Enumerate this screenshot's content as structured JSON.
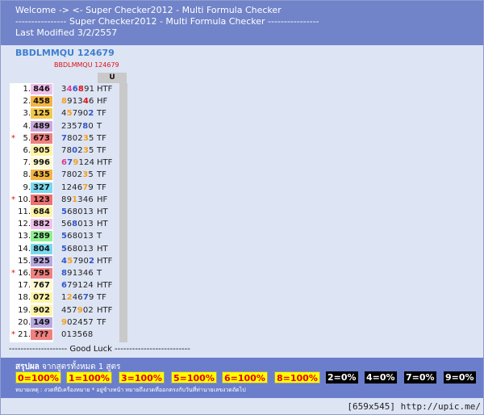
{
  "header": {
    "line1": "Welcome -> <- Super Checker2012 - Multi Formula Checker",
    "line2": "---------------- Super Checker2012 - Multi Formula Checker ----------------",
    "line3": "Last Modified 3/2/2557"
  },
  "code_title": "BBDLMMQU 124679",
  "code_sub": "BBDLMMQU 124679",
  "column_header": "U",
  "rows": [
    {
      "star": "",
      "idx": "1.",
      "num": "846",
      "bg": "#f1c0ea",
      "digits": [
        [
          "3",
          "#222"
        ],
        [
          "4",
          "#e03b8f"
        ],
        [
          "6",
          "#3355cc"
        ],
        [
          "8",
          "#dd1111"
        ],
        [
          "9",
          "#222"
        ],
        [
          "1",
          "#222"
        ]
      ],
      "type": "HTF"
    },
    {
      "star": "",
      "idx": "2.",
      "num": "458",
      "bg": "#f4b443",
      "digits": [
        [
          "8",
          "#f4a020"
        ],
        [
          "9",
          "#222"
        ],
        [
          "1",
          "#222"
        ],
        [
          "3",
          "#222"
        ],
        [
          "4",
          "#dd1111"
        ],
        [
          "6",
          "#222"
        ]
      ],
      "type": "HF"
    },
    {
      "star": "",
      "idx": "3.",
      "num": "125",
      "bg": "#f4c84a",
      "digits": [
        [
          "4",
          "#222"
        ],
        [
          "5",
          "#f4a020"
        ],
        [
          "7",
          "#222"
        ],
        [
          "9",
          "#222"
        ],
        [
          "0",
          "#222"
        ],
        [
          "2",
          "#3355cc"
        ]
      ],
      "type": "TF"
    },
    {
      "star": "",
      "idx": "4.",
      "num": "489",
      "bg": "#c9a9d9",
      "digits": [
        [
          "2",
          "#222"
        ],
        [
          "3",
          "#222"
        ],
        [
          "5",
          "#222"
        ],
        [
          "7",
          "#222"
        ],
        [
          "8",
          "#3355cc"
        ],
        [
          "0",
          "#222"
        ]
      ],
      "type": "T"
    },
    {
      "star": "*",
      "idx": "5.",
      "num": "673",
      "bg": "#f08080",
      "digits": [
        [
          "7",
          "#3355cc"
        ],
        [
          "8",
          "#222"
        ],
        [
          "0",
          "#222"
        ],
        [
          "2",
          "#222"
        ],
        [
          "3",
          "#f4a020"
        ],
        [
          "5",
          "#222"
        ]
      ],
      "type": "TF"
    },
    {
      "star": "",
      "idx": "6.",
      "num": "905",
      "bg": "#fff3a6",
      "digits": [
        [
          "7",
          "#222"
        ],
        [
          "8",
          "#222"
        ],
        [
          "0",
          "#3355cc"
        ],
        [
          "2",
          "#222"
        ],
        [
          "3",
          "#f4a020"
        ],
        [
          "5",
          "#222"
        ]
      ],
      "type": "TF"
    },
    {
      "star": "",
      "idx": "7.",
      "num": "996",
      "bg": "#fff8d0",
      "digits": [
        [
          "6",
          "#e03b8f"
        ],
        [
          "7",
          "#3355cc"
        ],
        [
          "9",
          "#f4a020"
        ],
        [
          "1",
          "#222"
        ],
        [
          "2",
          "#222"
        ],
        [
          "4",
          "#222"
        ]
      ],
      "type": "HTF"
    },
    {
      "star": "",
      "idx": "8.",
      "num": "435",
      "bg": "#f4b443",
      "digits": [
        [
          "7",
          "#222"
        ],
        [
          "8",
          "#222"
        ],
        [
          "0",
          "#222"
        ],
        [
          "2",
          "#222"
        ],
        [
          "3",
          "#f4a020"
        ],
        [
          "5",
          "#222"
        ]
      ],
      "type": "TF"
    },
    {
      "star": "",
      "idx": "9.",
      "num": "327",
      "bg": "#7ad9ee",
      "digits": [
        [
          "1",
          "#222"
        ],
        [
          "2",
          "#222"
        ],
        [
          "4",
          "#222"
        ],
        [
          "6",
          "#222"
        ],
        [
          "7",
          "#f4a020"
        ],
        [
          "9",
          "#222"
        ]
      ],
      "type": "TF"
    },
    {
      "star": "*",
      "idx": "10.",
      "num": "123",
      "bg": "#f07070",
      "digits": [
        [
          "8",
          "#222"
        ],
        [
          "9",
          "#222"
        ],
        [
          "1",
          "#f4a020"
        ],
        [
          "3",
          "#222"
        ],
        [
          "4",
          "#222"
        ],
        [
          "6",
          "#222"
        ]
      ],
      "type": "HF"
    },
    {
      "star": "",
      "idx": "11.",
      "num": "684",
      "bg": "#fff3a6",
      "digits": [
        [
          "5",
          "#3355cc"
        ],
        [
          "6",
          "#222"
        ],
        [
          "8",
          "#222"
        ],
        [
          "0",
          "#222"
        ],
        [
          "1",
          "#222"
        ],
        [
          "3",
          "#222"
        ]
      ],
      "type": "HT"
    },
    {
      "star": "",
      "idx": "12.",
      "num": "882",
      "bg": "#f1c0ea",
      "digits": [
        [
          "5",
          "#222"
        ],
        [
          "6",
          "#222"
        ],
        [
          "8",
          "#3355cc"
        ],
        [
          "0",
          "#222"
        ],
        [
          "1",
          "#222"
        ],
        [
          "3",
          "#222"
        ]
      ],
      "type": "HT"
    },
    {
      "star": "",
      "idx": "13.",
      "num": "289",
      "bg": "#8ef08e",
      "digits": [
        [
          "5",
          "#3355cc"
        ],
        [
          "6",
          "#222"
        ],
        [
          "8",
          "#222"
        ],
        [
          "0",
          "#222"
        ],
        [
          "1",
          "#222"
        ],
        [
          "3",
          "#222"
        ]
      ],
      "type": "T"
    },
    {
      "star": "",
      "idx": "14.",
      "num": "804",
      "bg": "#7ad9ee",
      "digits": [
        [
          "5",
          "#3355cc"
        ],
        [
          "6",
          "#222"
        ],
        [
          "8",
          "#222"
        ],
        [
          "0",
          "#222"
        ],
        [
          "1",
          "#222"
        ],
        [
          "3",
          "#222"
        ]
      ],
      "type": "HT"
    },
    {
      "star": "",
      "idx": "15.",
      "num": "925",
      "bg": "#b8a8e0",
      "digits": [
        [
          "4",
          "#3355cc"
        ],
        [
          "5",
          "#f4a020"
        ],
        [
          "7",
          "#222"
        ],
        [
          "9",
          "#222"
        ],
        [
          "0",
          "#222"
        ],
        [
          "2",
          "#3355cc"
        ]
      ],
      "type": "HTF"
    },
    {
      "star": "*",
      "idx": "16.",
      "num": "795",
      "bg": "#f08080",
      "digits": [
        [
          "8",
          "#3355cc"
        ],
        [
          "9",
          "#222"
        ],
        [
          "1",
          "#222"
        ],
        [
          "3",
          "#222"
        ],
        [
          "4",
          "#222"
        ],
        [
          "6",
          "#222"
        ]
      ],
      "type": "T"
    },
    {
      "star": "",
      "idx": "17.",
      "num": "767",
      "bg": "#fff8d0",
      "digits": [
        [
          "6",
          "#3355cc"
        ],
        [
          "7",
          "#222"
        ],
        [
          "9",
          "#222"
        ],
        [
          "1",
          "#222"
        ],
        [
          "2",
          "#222"
        ],
        [
          "4",
          "#222"
        ]
      ],
      "type": "HTF"
    },
    {
      "star": "",
      "idx": "18.",
      "num": "072",
      "bg": "#fff3a6",
      "digits": [
        [
          "1",
          "#222"
        ],
        [
          "2",
          "#f4a020"
        ],
        [
          "4",
          "#222"
        ],
        [
          "6",
          "#222"
        ],
        [
          "7",
          "#3355cc"
        ],
        [
          "9",
          "#222"
        ]
      ],
      "type": "TF"
    },
    {
      "star": "",
      "idx": "19.",
      "num": "902",
      "bg": "#fff3a6",
      "digits": [
        [
          "4",
          "#222"
        ],
        [
          "5",
          "#222"
        ],
        [
          "7",
          "#222"
        ],
        [
          "9",
          "#f4a020"
        ],
        [
          "0",
          "#222"
        ],
        [
          "2",
          "#222"
        ]
      ],
      "type": "HTF"
    },
    {
      "star": "",
      "idx": "20.",
      "num": "149",
      "bg": "#b8a8e0",
      "digits": [
        [
          "9",
          "#f4a020"
        ],
        [
          "0",
          "#222"
        ],
        [
          "2",
          "#222"
        ],
        [
          "4",
          "#222"
        ],
        [
          "5",
          "#222"
        ],
        [
          "7",
          "#222"
        ]
      ],
      "type": "TF"
    },
    {
      "star": "*",
      "idx": "21.",
      "num": "???",
      "bg": "#f08080",
      "digits": [
        [
          "0",
          "#222"
        ],
        [
          "1",
          "#222"
        ],
        [
          "3",
          "#222"
        ],
        [
          "5",
          "#222"
        ],
        [
          "6",
          "#222"
        ],
        [
          "8",
          "#222"
        ]
      ],
      "type": ""
    }
  ],
  "good_luck": "-------------------- Good Luck --------------------------",
  "summary": {
    "label_bold": "สรุปผล",
    "label_rest": " จากสูตรทั้งหมด 1 สูตร",
    "boxes": [
      {
        "text": "0=100%",
        "style": "y"
      },
      {
        "text": "1=100%",
        "style": "y"
      },
      {
        "text": "3=100%",
        "style": "y"
      },
      {
        "text": "5=100%",
        "style": "y"
      },
      {
        "text": "6=100%",
        "style": "y"
      },
      {
        "text": "8=100%",
        "style": "y"
      },
      {
        "text": "2=0%",
        "style": "k"
      },
      {
        "text": "4=0%",
        "style": "k"
      },
      {
        "text": "7=0%",
        "style": "k"
      },
      {
        "text": "9=0%",
        "style": "k"
      }
    ],
    "note": "หมายเหตุ : งวดที่มีเครื่องหมาย * อยู่ข้างหน้า หมายถึงงวดที่ออกตรงกับวันที่ท่านายเลขงวดถัดไป"
  },
  "footer": "[659x545] http://upic.me/"
}
